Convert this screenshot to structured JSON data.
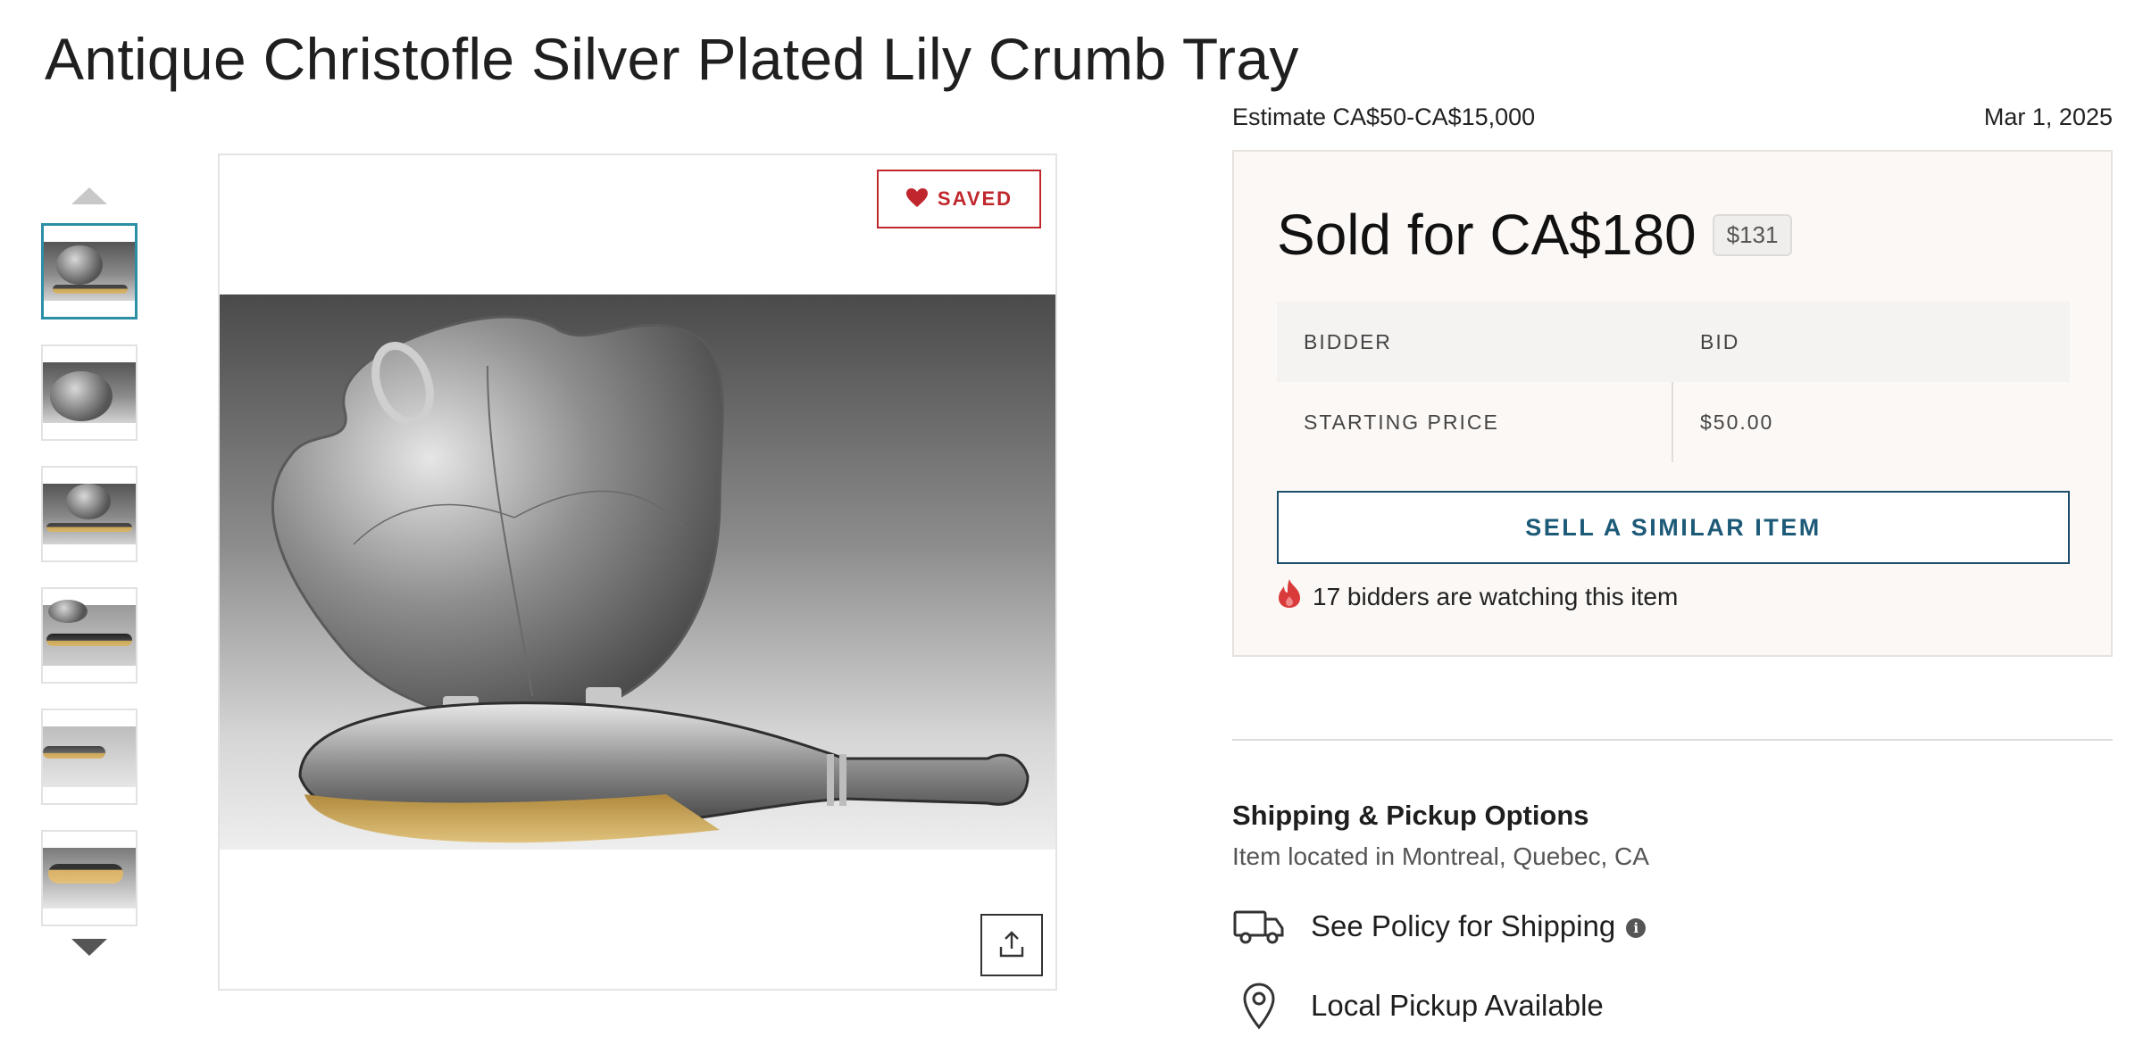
{
  "item": {
    "title": "Antique Christofle Silver Plated Lily Crumb Tray"
  },
  "gallery": {
    "thumbnail_count": 6,
    "active_index": 0,
    "saved_label": "SAVED",
    "icons": {
      "up": "chevron-up-icon",
      "down": "chevron-down-icon",
      "saved": "heart-icon",
      "share": "share-icon"
    }
  },
  "auction": {
    "estimate": "Estimate CA$50-CA$15,000",
    "date": "Mar 1, 2025",
    "sold_label": "Sold for CA$180",
    "usd_price": "$131",
    "table": {
      "headers": [
        "BIDDER",
        "BID"
      ],
      "rows": [
        {
          "bidder": "STARTING PRICE",
          "bid": "$50.00"
        }
      ]
    },
    "sell_similar_label": "SELL A SIMILAR ITEM",
    "watching_text": "17 bidders are watching this item"
  },
  "shipping": {
    "heading": "Shipping & Pickup Options",
    "location": "Item located in Montreal, Quebec, CA",
    "options": [
      {
        "icon": "truck-icon",
        "label": "See Policy for Shipping"
      },
      {
        "icon": "map-pin-icon",
        "label": "Local Pickup Available"
      }
    ]
  },
  "colors": {
    "accent_red": "#c0272d",
    "accent_blue": "#1d5a78",
    "active_thumb_border": "#2b8fa6",
    "panel_bg": "#fcf8f5"
  }
}
